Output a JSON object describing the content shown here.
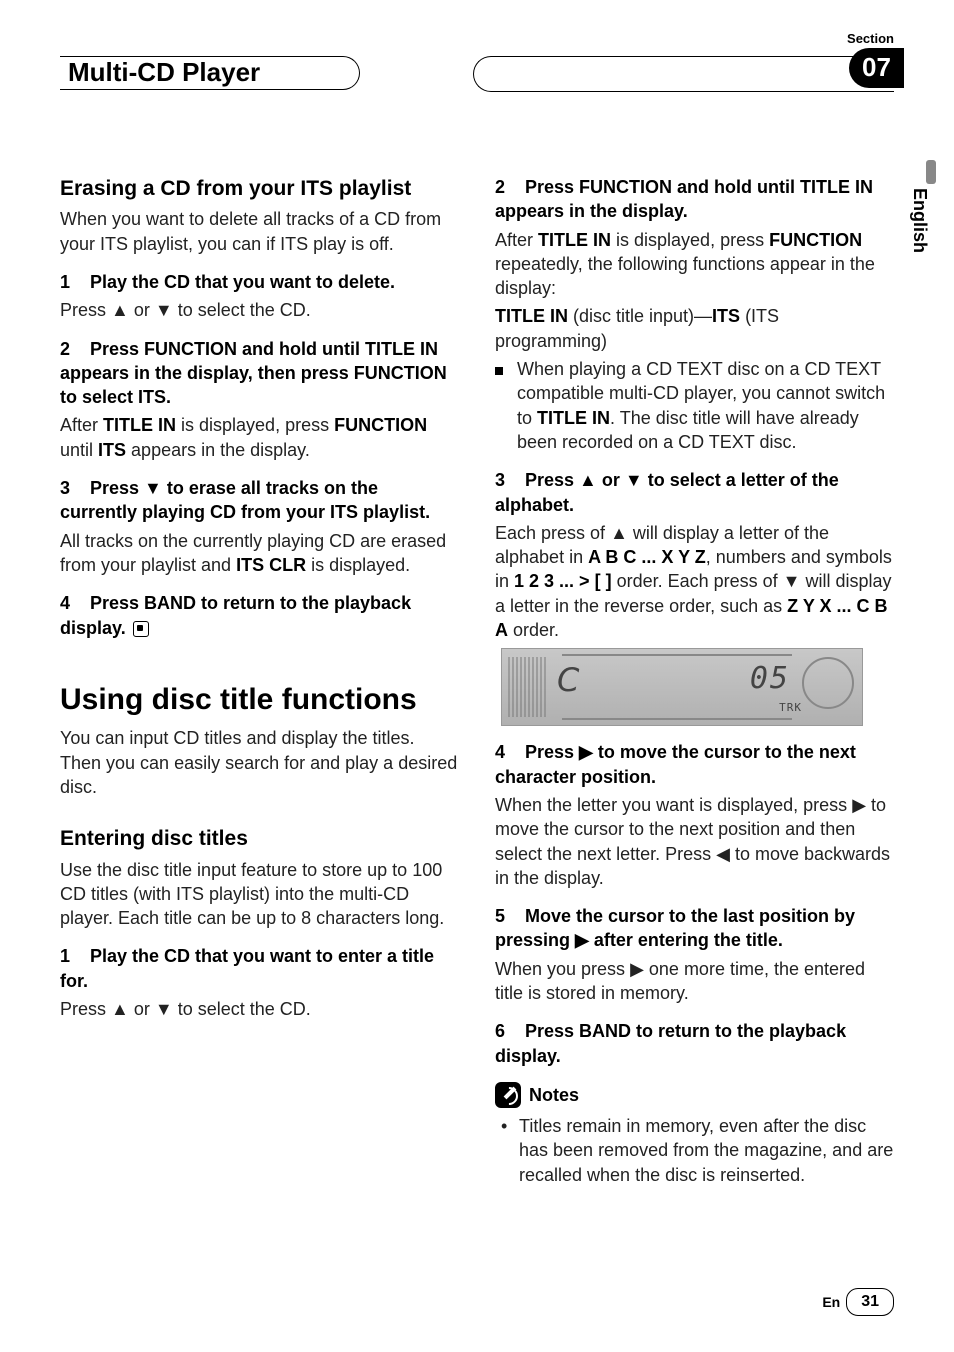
{
  "header": {
    "title": "Multi-CD Player",
    "section_label": "Section",
    "section_number": "07"
  },
  "language_tab": "English",
  "footer": {
    "lang_code": "En",
    "page_number": "31"
  },
  "symbols": {
    "up": "▲",
    "down": "▼",
    "right": "▶",
    "left": "◀"
  },
  "left": {
    "h2a": "Erasing a CD from your ITS playlist",
    "intro": "When you want to delete all tracks of a CD from your ITS playlist, you can if ITS play is off.",
    "s1_lead": "Play the CD that you want to delete.",
    "s1_body_a": "Press ",
    "s1_body_b": " or ",
    "s1_body_c": " to select the CD.",
    "s2_lead": "Press FUNCTION and hold until TITLE IN appears in the display, then press FUNCTION to select ITS.",
    "s2_body_a": "After ",
    "s2_body_b": "TITLE IN",
    "s2_body_c": " is displayed, press ",
    "s2_body_d": "FUNCTION",
    "s2_body_e": " until ",
    "s2_body_f": "ITS",
    "s2_body_g": " appears in the display.",
    "s3_lead_a": "Press ",
    "s3_lead_b": " to erase all tracks on the currently playing CD from your ITS playlist.",
    "s3_body_a": "All tracks on the currently playing CD are erased from your playlist and ",
    "s3_body_b": "ITS CLR",
    "s3_body_c": " is displayed.",
    "s4_lead": "Press BAND to return to the playback display.",
    "h1": "Using disc title functions",
    "p_after_h1": "You can input CD titles and display the titles. Then you can easily search for and play a desired disc.",
    "h2b": "Entering disc titles",
    "p_after_h2b": "Use the disc title input feature to store up to 100 CD titles  (with ITS playlist) into the multi-CD player. Each title can be up to 8 characters long.",
    "sb1_lead": "Play the CD that you want to enter a title for.",
    "sb1_body_a": "Press ",
    "sb1_body_b": " or ",
    "sb1_body_c": " to select the CD."
  },
  "right": {
    "s2_lead": "Press FUNCTION and hold until TITLE IN appears in the display.",
    "s2_body_a": "After ",
    "s2_body_b": "TITLE IN",
    "s2_body_c": " is displayed, press ",
    "s2_body_d": "FUNCTION",
    "s2_body_e": " repeatedly, the following functions appear in the display:",
    "s2_body_f": "TITLE IN",
    "s2_body_g": " (disc title input)—",
    "s2_body_h": "ITS",
    "s2_body_i": " (ITS programming)",
    "s2_bullet_a": "When playing a CD TEXT disc on a CD TEXT compatible multi-CD player, you cannot switch to ",
    "s2_bullet_b": "TITLE IN",
    "s2_bullet_c": ". The disc title will have already been recorded on a CD TEXT disc.",
    "s3_lead_a": "Press ",
    "s3_lead_b": " or ",
    "s3_lead_c": " to select a letter of the alphabet.",
    "s3_body_a": "Each press of ",
    "s3_body_b": " will display a letter of the alphabet in ",
    "s3_body_c": "A B C ... X Y Z",
    "s3_body_d": ", numbers and symbols in ",
    "s3_body_e": "1 2 3 ... > [ ]",
    "s3_body_f": " order. Each press of ",
    "s3_body_g": " will display a letter in the reverse order, such as ",
    "s3_body_h": "Z Y X ... C B A",
    "s3_body_i": " order.",
    "display": {
      "trk": "TRK",
      "seg": "05"
    },
    "s4_lead_a": "Press ",
    "s4_lead_b": " to move the cursor to the next character position.",
    "s4_body_a": "When the letter you want is displayed, press ",
    "s4_body_b": " to move the cursor to the next position and then select the next letter. Press ",
    "s4_body_c": " to move backwards in the display.",
    "s5_lead_a": "Move the cursor to the last position by pressing ",
    "s5_lead_b": " after entering the title.",
    "s5_body_a": "When you press ",
    "s5_body_b": " one more time, the entered title is stored in memory.",
    "s6_lead": "Press BAND to return to the playback display.",
    "notes_title": "Notes",
    "note1": "Titles remain in memory, even after the disc has been removed from the magazine, and are recalled when the disc is reinserted."
  },
  "nums": {
    "n1": "1",
    "n2": "2",
    "n3": "3",
    "n4": "4",
    "n5": "5",
    "n6": "6"
  }
}
